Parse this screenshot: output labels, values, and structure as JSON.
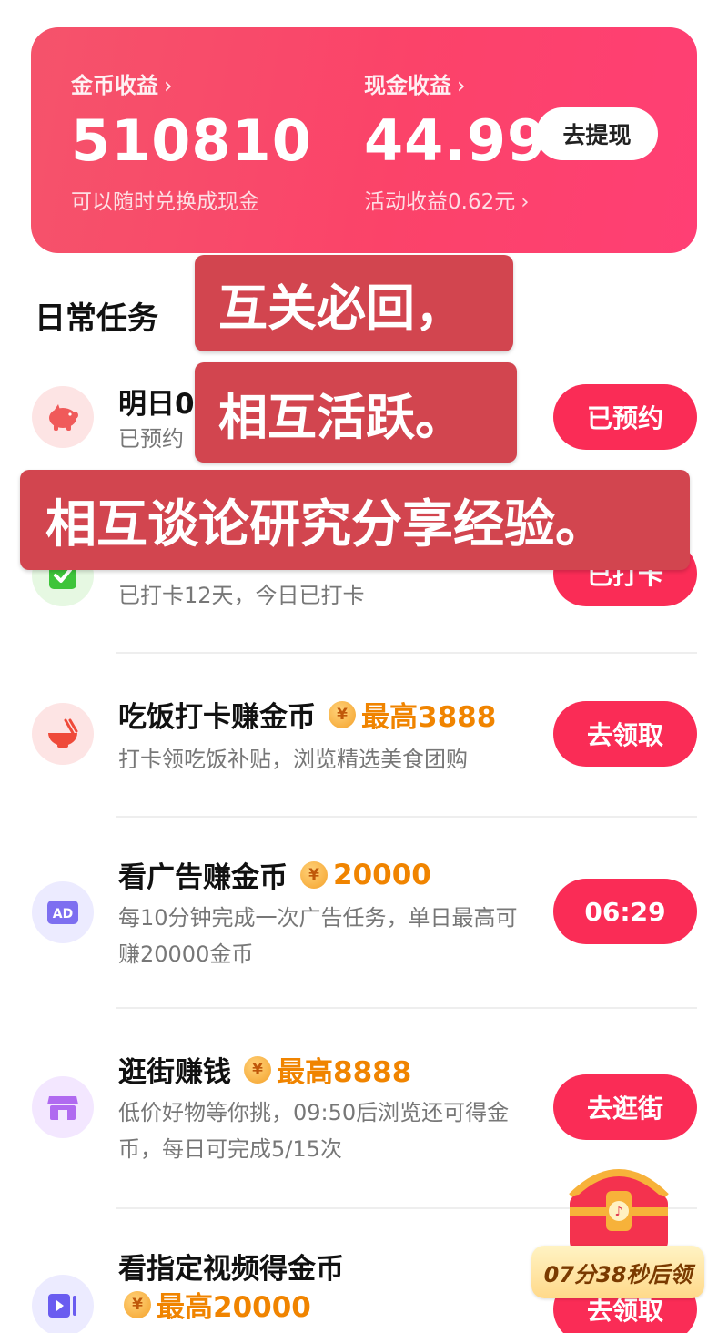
{
  "earnings": {
    "coin_label": "金币收益",
    "coin_value": "510810",
    "coin_sub": "可以随时兑换成现金",
    "cash_label": "现金收益",
    "cash_value": "44.99",
    "cash_sub": "活动收益0.62元",
    "withdraw_label": "去提现",
    "chevron": "›"
  },
  "section_title": "日常任务",
  "tasks": [
    {
      "icon": "piggy-bank-icon",
      "title": "明日0",
      "desc": "已预约",
      "button": "已预约"
    },
    {
      "icon": "check-icon",
      "title": "",
      "desc": "已打卡12天，今日已打卡",
      "button": "已打卡"
    },
    {
      "icon": "rice-bowl-icon",
      "title": "吃饭打卡赚金币",
      "reward": "最高3888",
      "desc": "打卡领吃饭补贴，浏览精选美食团购",
      "button": "去领取"
    },
    {
      "icon": "ad-icon",
      "title": "看广告赚金币",
      "reward": "20000",
      "desc": "每10分钟完成一次广告任务，单日最高可赚20000金币",
      "button": "06:29"
    },
    {
      "icon": "shop-icon",
      "title": "逛街赚钱",
      "reward": "最高8888",
      "desc": "低价好物等你挑，09:50后浏览还可得金币，每日可完成5/15次",
      "button": "去逛街"
    },
    {
      "icon": "video-icon",
      "title": "看指定视频得金币",
      "reward": "最高20000",
      "desc": "",
      "button": "去领取"
    }
  ],
  "coin_symbol": "¥",
  "overlay": {
    "line1": "互关必回，",
    "line2": "相互活跃。",
    "line3": "相互谈论研究分享经验。"
  },
  "chest": {
    "timer": "07分38秒后领"
  },
  "colors": {
    "primary": "#fa2c56",
    "card_start": "#f5536b",
    "card_end": "#ff3f74",
    "reward": "#f08400",
    "overlay": "#d2454f"
  }
}
